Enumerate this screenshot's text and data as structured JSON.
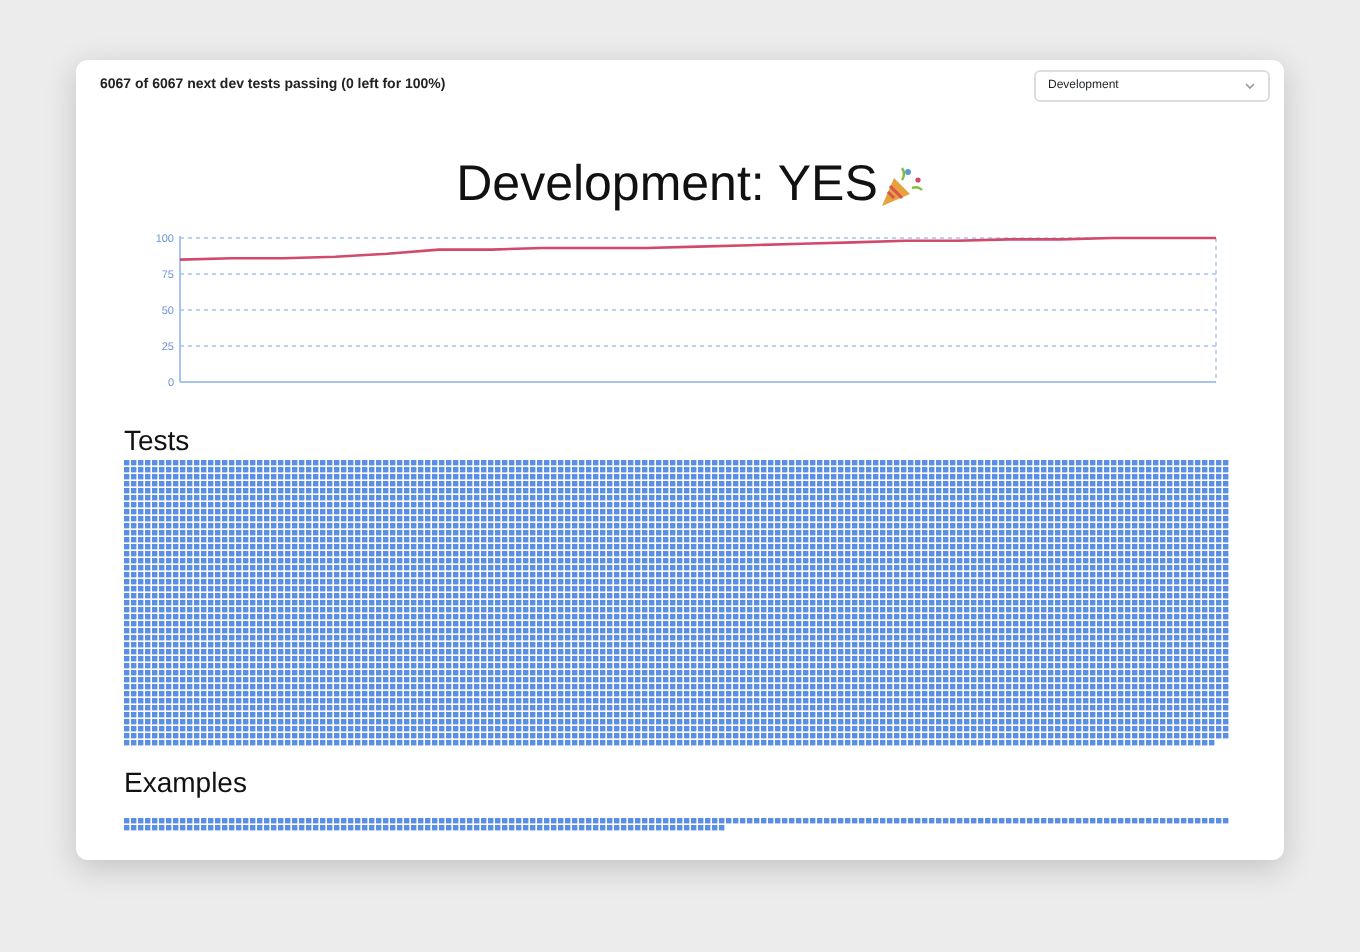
{
  "header": {
    "summary": "6067 of 6067 next dev tests passing (0 left for 100%)",
    "mode_select": {
      "value": "Development"
    }
  },
  "title": "Development: YES",
  "chart": {
    "chart_data": {
      "type": "line",
      "grid": true,
      "ylim": [
        0,
        100
      ],
      "yticks": [
        0,
        25,
        50,
        75,
        100
      ],
      "series": [
        {
          "color": "#d14a6a",
          "values": [
            85,
            86,
            86,
            87,
            89,
            92,
            92,
            93,
            93,
            93,
            94,
            95,
            96,
            97,
            98,
            98,
            99,
            99,
            100,
            100,
            100
          ]
        }
      ]
    }
  },
  "sections": [
    {
      "heading": "Tests",
      "kind": "picture"
    },
    {
      "heading": "Examples",
      "kind": "picture"
    }
  ]
}
